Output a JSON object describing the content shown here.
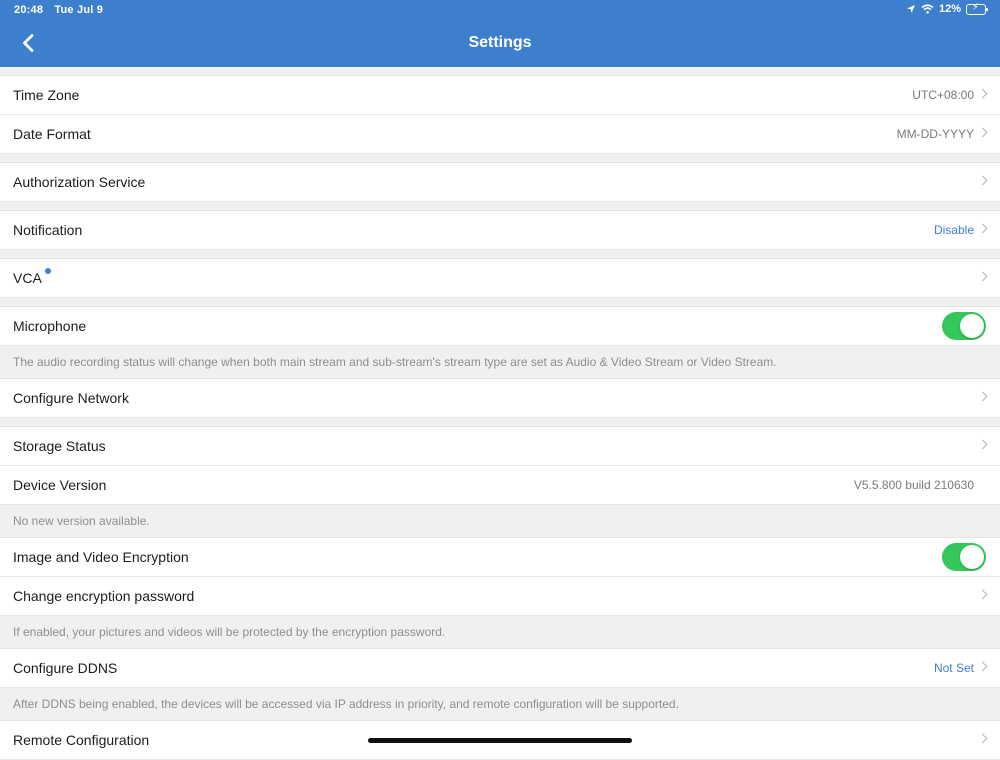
{
  "status_bar": {
    "time": "20:48",
    "date": "Tue Jul 9",
    "battery": "12%"
  },
  "nav": {
    "title": "Settings"
  },
  "rows": {
    "time_zone": {
      "label": "Time Zone",
      "value": "UTC+08:00"
    },
    "date_format": {
      "label": "Date Format",
      "value": "MM-DD-YYYY"
    },
    "authorization": {
      "label": "Authorization Service"
    },
    "notification": {
      "label": "Notification",
      "value": "Disable"
    },
    "vca": {
      "label": "VCA"
    },
    "microphone": {
      "label": "Microphone",
      "enabled": true
    },
    "microphone_note": "The audio recording status will change when both main stream and sub-stream's stream type are set as Audio & Video Stream or Video Stream.",
    "configure_network": {
      "label": "Configure Network"
    },
    "storage_status": {
      "label": "Storage Status"
    },
    "device_version": {
      "label": "Device Version",
      "value": "V5.5.800 build 210630"
    },
    "device_version_note": "No new version available.",
    "encryption": {
      "label": "Image and Video Encryption",
      "enabled": true
    },
    "encryption_password": {
      "label": "Change encryption password"
    },
    "encryption_note": "If enabled, your pictures and videos will be protected by the encryption password.",
    "ddns": {
      "label": "Configure DDNS",
      "value": "Not Set"
    },
    "ddns_note": "After DDNS being enabled, the devices will be accessed via IP address in priority, and remote configuration will be supported.",
    "remote_config": {
      "label": "Remote Configuration"
    }
  },
  "colors": {
    "header": "#3e7fcd",
    "accent": "#3f7fd0",
    "toggle_on": "#34c759"
  }
}
